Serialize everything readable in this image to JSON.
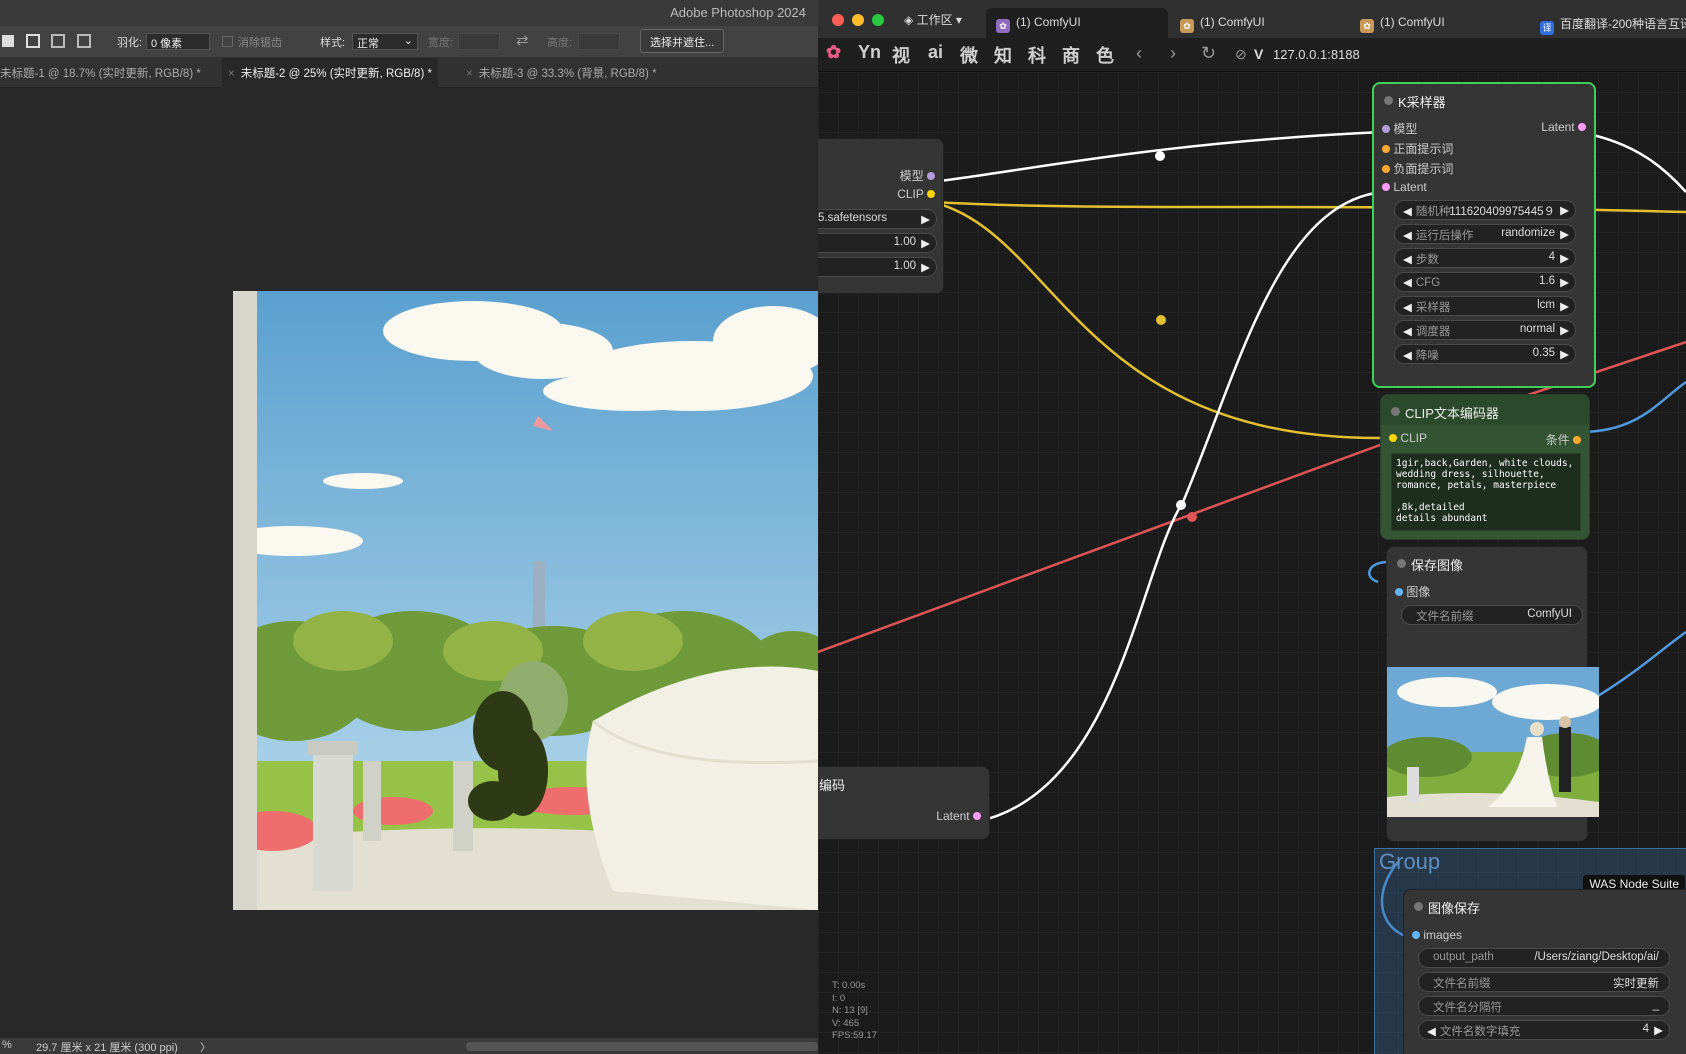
{
  "photoshop": {
    "app_title": "Adobe Photoshop 2024",
    "options": {
      "feather_label": "羽化:",
      "feather_value": "0 像素",
      "antialias": "消除锯齿",
      "style_label": "样式:",
      "style_value": "正常",
      "width_label": "宽度:",
      "height_label": "高度:",
      "select_mask": "选择并遮住..."
    },
    "tabs": [
      {
        "label": "未标题-1 @ 18.7% (实时更新, RGB/8) *"
      },
      {
        "label": "未标题-2 @ 25% (实时更新, RGB/8) *"
      },
      {
        "label": "未标题-3 @ 33.3% (背景, RGB/8) *"
      }
    ],
    "status": {
      "zoom": "%",
      "doc_size": "29.7 厘米 x 21 厘米 (300 ppi)",
      "arrow": "〉"
    }
  },
  "browser": {
    "workspace": "工作区",
    "tabs": [
      {
        "label": "(1) ComfyUI"
      },
      {
        "label": "(1) ComfyUI"
      },
      {
        "label": "(1) ComfyUI"
      },
      {
        "label": "百度翻译-200种语言互译"
      }
    ],
    "bookmarks": [
      "Yn",
      "视",
      "ai",
      "微",
      "知",
      "科",
      "商",
      "色"
    ],
    "url": "127.0.0.1:8188"
  },
  "comfy": {
    "checkpoint": {
      "out_model": "模型",
      "out_clip": "CLIP",
      "ckpt_name": "5.safetensors",
      "w1": "1.00",
      "w2": "1.00"
    },
    "ksampler": {
      "title": "K采样器",
      "in_model": "模型",
      "in_positive": "正面提示词",
      "in_negative": "负面提示词",
      "in_latent": "Latent",
      "out_latent": "Latent",
      "widgets": [
        {
          "label": "随机种",
          "value": "111620409975445９"
        },
        {
          "label": "运行后操作",
          "value": "randomize"
        },
        {
          "label": "步数",
          "value": "4"
        },
        {
          "label": "CFG",
          "value": "1.6"
        },
        {
          "label": "采样器",
          "value": "lcm"
        },
        {
          "label": "调度器",
          "value": "normal"
        },
        {
          "label": "降噪",
          "value": "0.35"
        }
      ]
    },
    "clip_encoder": {
      "title": "CLIP文本编码器",
      "in_clip": "CLIP",
      "out_cond": "条件",
      "prompt": "1gir,back,Garden, white clouds, wedding dress, silhouette, romance, petals, masterpiece\n\n,8k,detailed\ndetails abundant"
    },
    "save_image": {
      "title": "保存图像",
      "in_images": "图像",
      "prefix_label": "文件名前缀",
      "prefix_value": "ComfyUI"
    },
    "vae_encode": {
      "title": "编码",
      "out_latent": "Latent"
    },
    "group": {
      "title": "Group",
      "badge": "WAS Node Suite"
    },
    "image_save": {
      "title": "图像保存",
      "in_images": "images",
      "widgets": [
        {
          "label": "output_path",
          "value": "/Users/ziang/Desktop/ai/"
        },
        {
          "label": "文件名前缀",
          "value": "实时更新"
        },
        {
          "label": "文件名分隔符",
          "value": "_"
        },
        {
          "label": "文件名数字填充",
          "value": "4"
        }
      ]
    },
    "perf": {
      "t": "T: 0.00s",
      "i": "I: 0",
      "n": "N: 13 [9]",
      "v": "V: 465",
      "fps": "FPS:59.17"
    }
  },
  "colors": {
    "model": "#b39ddb",
    "clip": "#ffd500",
    "latent": "#ff9cf9",
    "conditioning": "#ffa931",
    "image": "#64b5f6",
    "vae": "#ff6e6e",
    "selected_border": "#3fd05b"
  }
}
